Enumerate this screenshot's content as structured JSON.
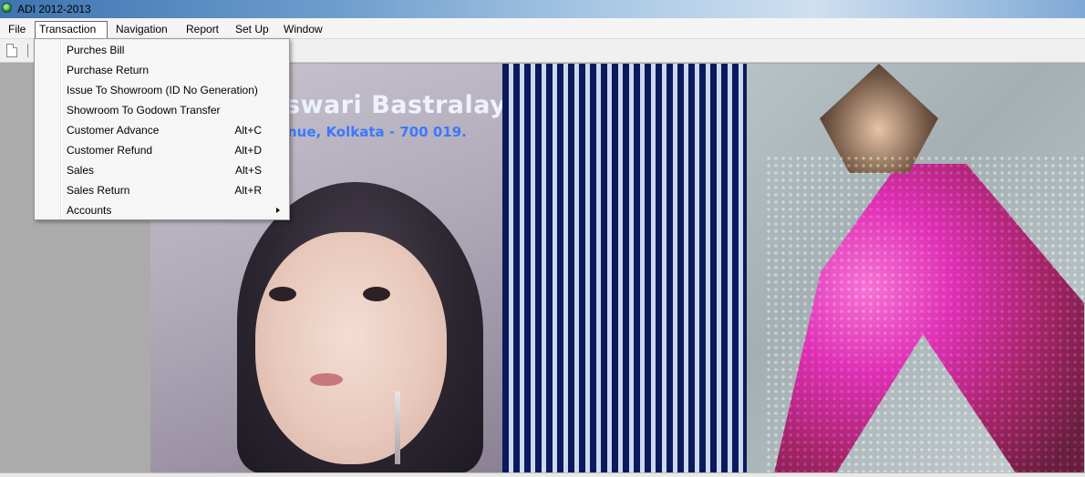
{
  "window": {
    "title": "ADI 2012-2013",
    "icon": "globe-app-icon"
  },
  "menubar": {
    "items": [
      {
        "label": "File"
      },
      {
        "label": "Transaction",
        "open": true
      },
      {
        "label": "Navigation"
      },
      {
        "label": "Report"
      },
      {
        "label": "Set Up"
      },
      {
        "label": "Window"
      }
    ]
  },
  "toolbar": {
    "icons": [
      "new-document-icon",
      "separator"
    ]
  },
  "transaction_menu": {
    "items": [
      {
        "label": "Purches Bill",
        "shortcut": ""
      },
      {
        "label": "Purchase Return",
        "shortcut": ""
      },
      {
        "label": "Issue To Showroom (ID No Generation)",
        "shortcut": ""
      },
      {
        "label": "Showroom To Godown Transfer",
        "shortcut": ""
      },
      {
        "label": "Customer Advance",
        "shortcut": "Alt+C"
      },
      {
        "label": "Customer Refund",
        "shortcut": "Alt+D"
      },
      {
        "label": "Sales",
        "shortcut": "Alt+S"
      },
      {
        "label": "Sales Return",
        "shortcut": "Alt+R"
      },
      {
        "label": "Accounts",
        "shortcut": "",
        "submenu": true
      }
    ]
  },
  "banner": {
    "shop_name": "swari Bastralaya",
    "address": "nue, Kolkata - 700 019.",
    "colors": {
      "name": "#eef2ff",
      "address": "#3a78ff",
      "stripes_dark": "#0b1a5c",
      "figure_pink": "#e322b0"
    }
  }
}
